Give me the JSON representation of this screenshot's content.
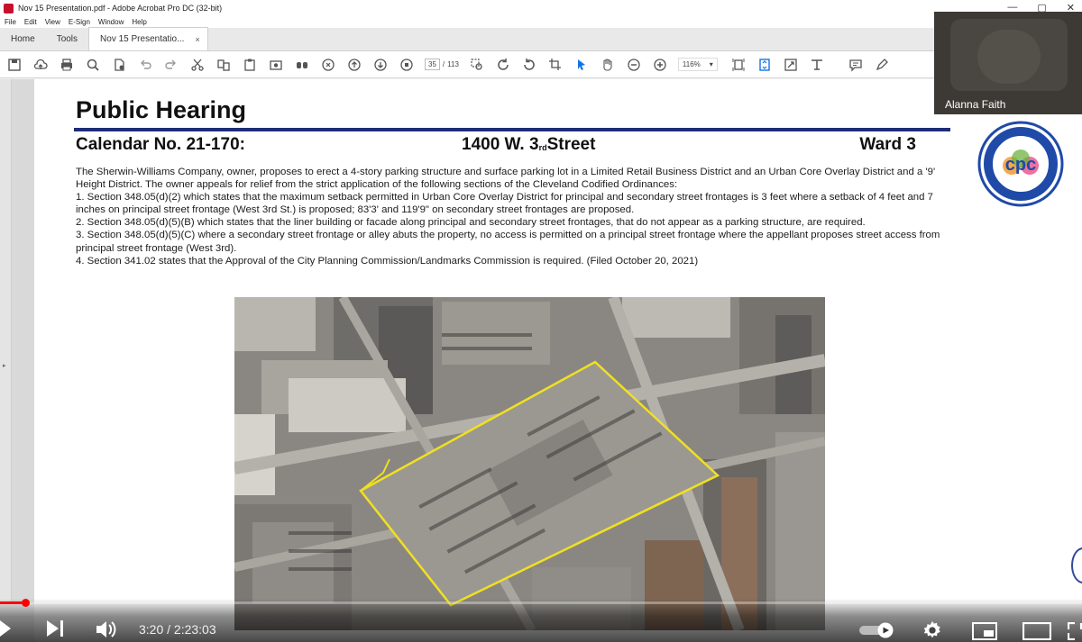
{
  "window": {
    "title": "Nov 15 Presentation.pdf - Adobe Acrobat Pro DC (32-bit)",
    "controls": [
      "—",
      "▢",
      "✕"
    ]
  },
  "menu": [
    "File",
    "Edit",
    "View",
    "E-Sign",
    "Window",
    "Help"
  ],
  "tabs": {
    "home": "Home",
    "tools": "Tools",
    "document": "Nov 15 Presentatio...",
    "close": "×"
  },
  "toolbar": {
    "page_current": "35",
    "page_sep": "/",
    "page_total": "113",
    "zoom": "116%",
    "zoom_arrow": "▾"
  },
  "slide": {
    "title": "Public Hearing",
    "calendar": "Calendar No. 21-170:",
    "address_main": "1400 W. 3",
    "address_sup": "rd",
    "address_end": "Street",
    "ward": "Ward 3",
    "paragraphs": [
      "The Sherwin-Williams Company, owner, proposes to erect a 4-story parking structure and surface parking lot in a Limited Retail Business District and an Urban Core Overlay District and a '9' Height District. The owner appeals for relief from the strict application of the following sections of the Cleveland Codified Ordinances:",
      "1. Section 348.05(d)(2) which states that the maximum setback permitted in Urban Core Overlay District for principal and secondary street frontages is 3 feet where a setback of 4 feet and 7 inches on principal street frontage (West 3rd St.) is proposed; 83'3' and 119'9\" on secondary street frontages are proposed.",
      "2. Section 348.05(d)(5)(B) which states that the liner building or facade along principal and secondary street frontages, that do not appear as a parking structure, are required.",
      "3. Section 348.05(d)(5)(C) where a secondary street frontage or alley abuts the property, no access is permitted on a principal street frontage where the appellant proposes street access from principal street frontage (West 3rd).",
      "4. Section 341.02 states that the Approval of the City Planning Commission/Landmarks Commission is required. (Filed October 20, 2021)"
    ],
    "seal_text": "cpc"
  },
  "webcam": {
    "name": "Alanna Faith"
  },
  "video": {
    "current_time": "3:20",
    "separator": " / ",
    "duration": "2:23:03",
    "progress_fraction": 0.0233
  },
  "colors": {
    "rule": "#1f2c77",
    "progress": "#ff0000",
    "seal_blue": "#1f4aa8",
    "boundary": "#f0e020"
  }
}
